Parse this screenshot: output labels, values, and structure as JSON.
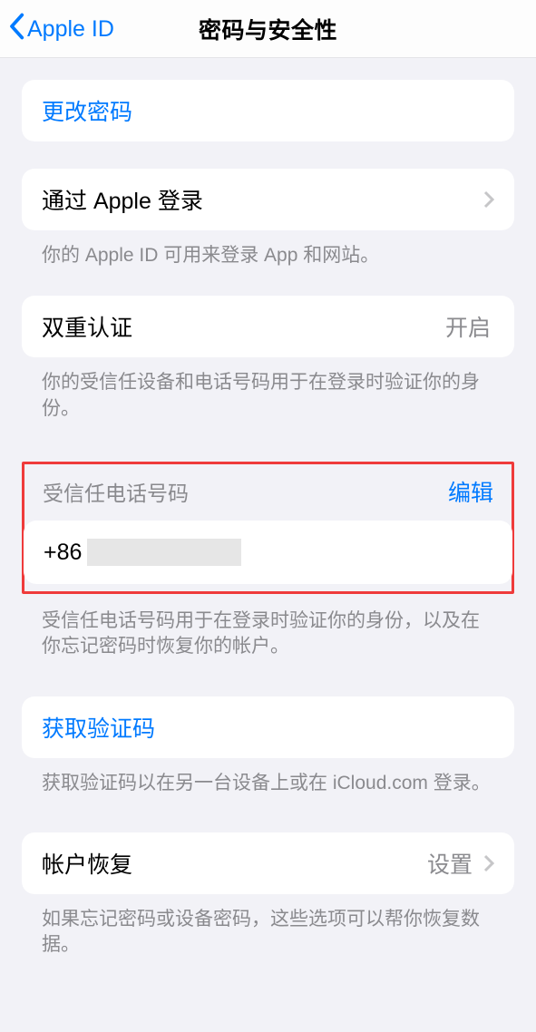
{
  "header": {
    "back_label": "Apple ID",
    "title": "密码与安全性"
  },
  "group_change_password": {
    "label": "更改密码"
  },
  "group_sign_in_apple": {
    "label": "通过 Apple 登录",
    "footer": "你的 Apple ID 可用来登录 App 和网站。"
  },
  "group_two_factor": {
    "label": "双重认证",
    "value": "开启",
    "footer": "你的受信任设备和电话号码用于在登录时验证你的身份。"
  },
  "trusted_numbers": {
    "header": "受信任电话号码",
    "edit_label": "编辑",
    "phone_prefix": "+86",
    "footer": "受信任电话号码用于在登录时验证你的身份，以及在你忘记密码时恢复你的帐户。"
  },
  "group_get_code": {
    "label": "获取验证码",
    "footer": "获取验证码以在另一台设备上或在 iCloud.com 登录。"
  },
  "group_account_recovery": {
    "label": "帐户恢复",
    "value": "设置",
    "footer": "如果忘记密码或设备密码，这些选项可以帮你恢复数据。"
  }
}
